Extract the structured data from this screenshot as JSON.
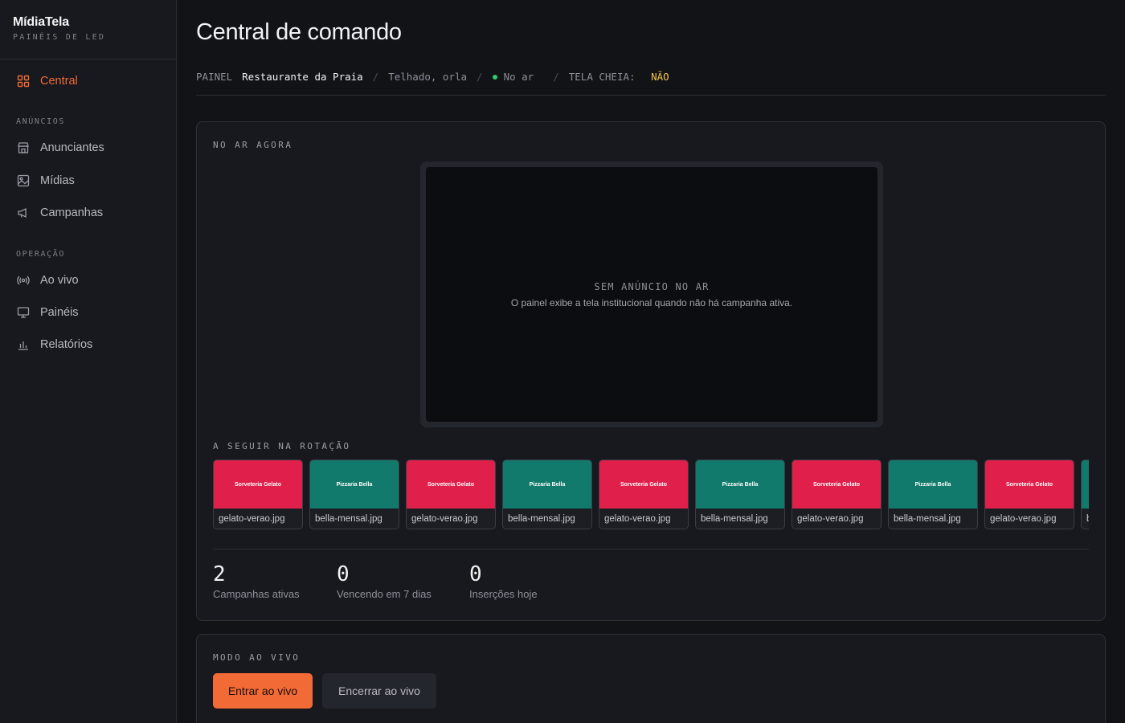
{
  "brand": {
    "name": "MídiaTela",
    "subtitle": "PAINÉIS DE LED"
  },
  "sidebar": {
    "items": [
      {
        "label": "Central",
        "icon": "grid-icon",
        "active": true
      },
      {
        "label": "Anunciantes",
        "icon": "store-icon"
      },
      {
        "label": "Mídias",
        "icon": "image-icon"
      },
      {
        "label": "Campanhas",
        "icon": "megaphone-icon"
      },
      {
        "label": "Ao vivo",
        "icon": "broadcast-icon"
      },
      {
        "label": "Painéis",
        "icon": "monitor-icon"
      },
      {
        "label": "Relatórios",
        "icon": "bar-chart-icon"
      }
    ],
    "sections": {
      "ads": "ANÚNCIOS",
      "ops": "OPERAÇÃO"
    }
  },
  "page": {
    "title": "Central de comando"
  },
  "breadcrumb": {
    "panel_label": "PAINEL",
    "panel_name": "Restaurante da Praia",
    "location": "Telhado, orla",
    "status": "No ar",
    "fullscreen_label": "TELA CHEIA:",
    "fullscreen_value": "NÃO",
    "separator": "/"
  },
  "on_air": {
    "label": "NO AR AGORA",
    "empty_title": "SEM ANÚNCIO NO AR",
    "empty_subtitle": "O painel exibe a tela institucional quando não há campanha ativa."
  },
  "rotation": {
    "label": "A SEGUIR NA ROTAÇÃO",
    "items": [
      {
        "advertiser": "Sorveteria Gelato",
        "file": "gelato-verao.jpg",
        "color": "#e01f4b"
      },
      {
        "advertiser": "Pizzaria Bella",
        "file": "bella-mensal.jpg",
        "color": "#127a6c"
      },
      {
        "advertiser": "Sorveteria Gelato",
        "file": "gelato-verao.jpg",
        "color": "#e01f4b"
      },
      {
        "advertiser": "Pizzaria Bella",
        "file": "bella-mensal.jpg",
        "color": "#127a6c"
      },
      {
        "advertiser": "Sorveteria Gelato",
        "file": "gelato-verao.jpg",
        "color": "#e01f4b"
      },
      {
        "advertiser": "Pizzaria Bella",
        "file": "bella-mensal.jpg",
        "color": "#127a6c"
      },
      {
        "advertiser": "Sorveteria Gelato",
        "file": "gelato-verao.jpg",
        "color": "#e01f4b"
      },
      {
        "advertiser": "Pizzaria Bella",
        "file": "bella-mensal.jpg",
        "color": "#127a6c"
      },
      {
        "advertiser": "Sorveteria Gelato",
        "file": "gelato-verao.jpg",
        "color": "#e01f4b"
      },
      {
        "advertiser": "Pizzaria Bella",
        "file": "bella-mensal.jpg",
        "color": "#127a6c"
      }
    ]
  },
  "stats": [
    {
      "value": "2",
      "label": "Campanhas ativas"
    },
    {
      "value": "0",
      "label": "Vencendo em 7 dias"
    },
    {
      "value": "0",
      "label": "Inserções hoje"
    }
  ],
  "live_mode": {
    "label": "MODO AO VIVO",
    "enter_button": "Entrar ao vivo",
    "exit_button": "Encerrar ao vivo"
  },
  "colors": {
    "accent": "#f26a36",
    "status_on_air": "#2ecc71",
    "warning": "#f5c542",
    "gelato": "#e01f4b",
    "bella": "#127a6c"
  }
}
